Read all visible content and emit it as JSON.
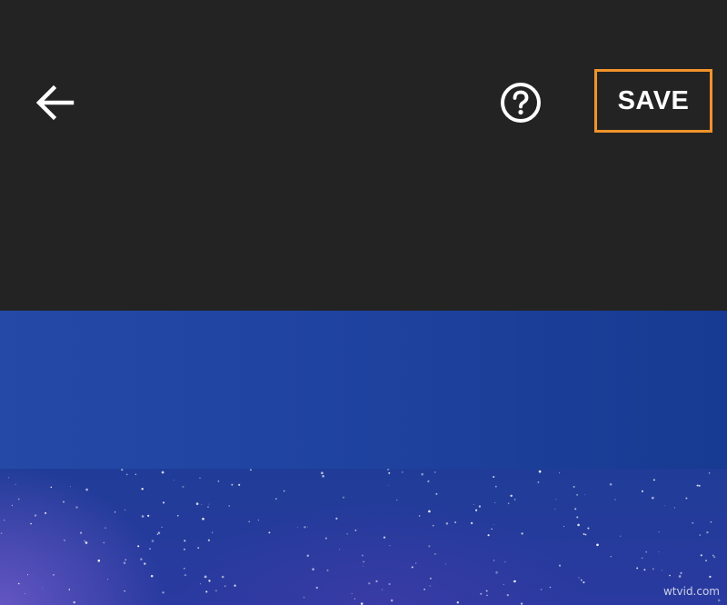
{
  "toolbar": {
    "back_icon": "arrow-left-icon",
    "help_icon": "help-circle-icon",
    "save_label": "SAVE",
    "highlight_color": "#f0932b",
    "background_color": "#232323"
  },
  "preview": {
    "description_colors": [
      "#2449a6",
      "#203c98",
      "#6e5ac8"
    ],
    "watermark": "wtvid.com"
  }
}
